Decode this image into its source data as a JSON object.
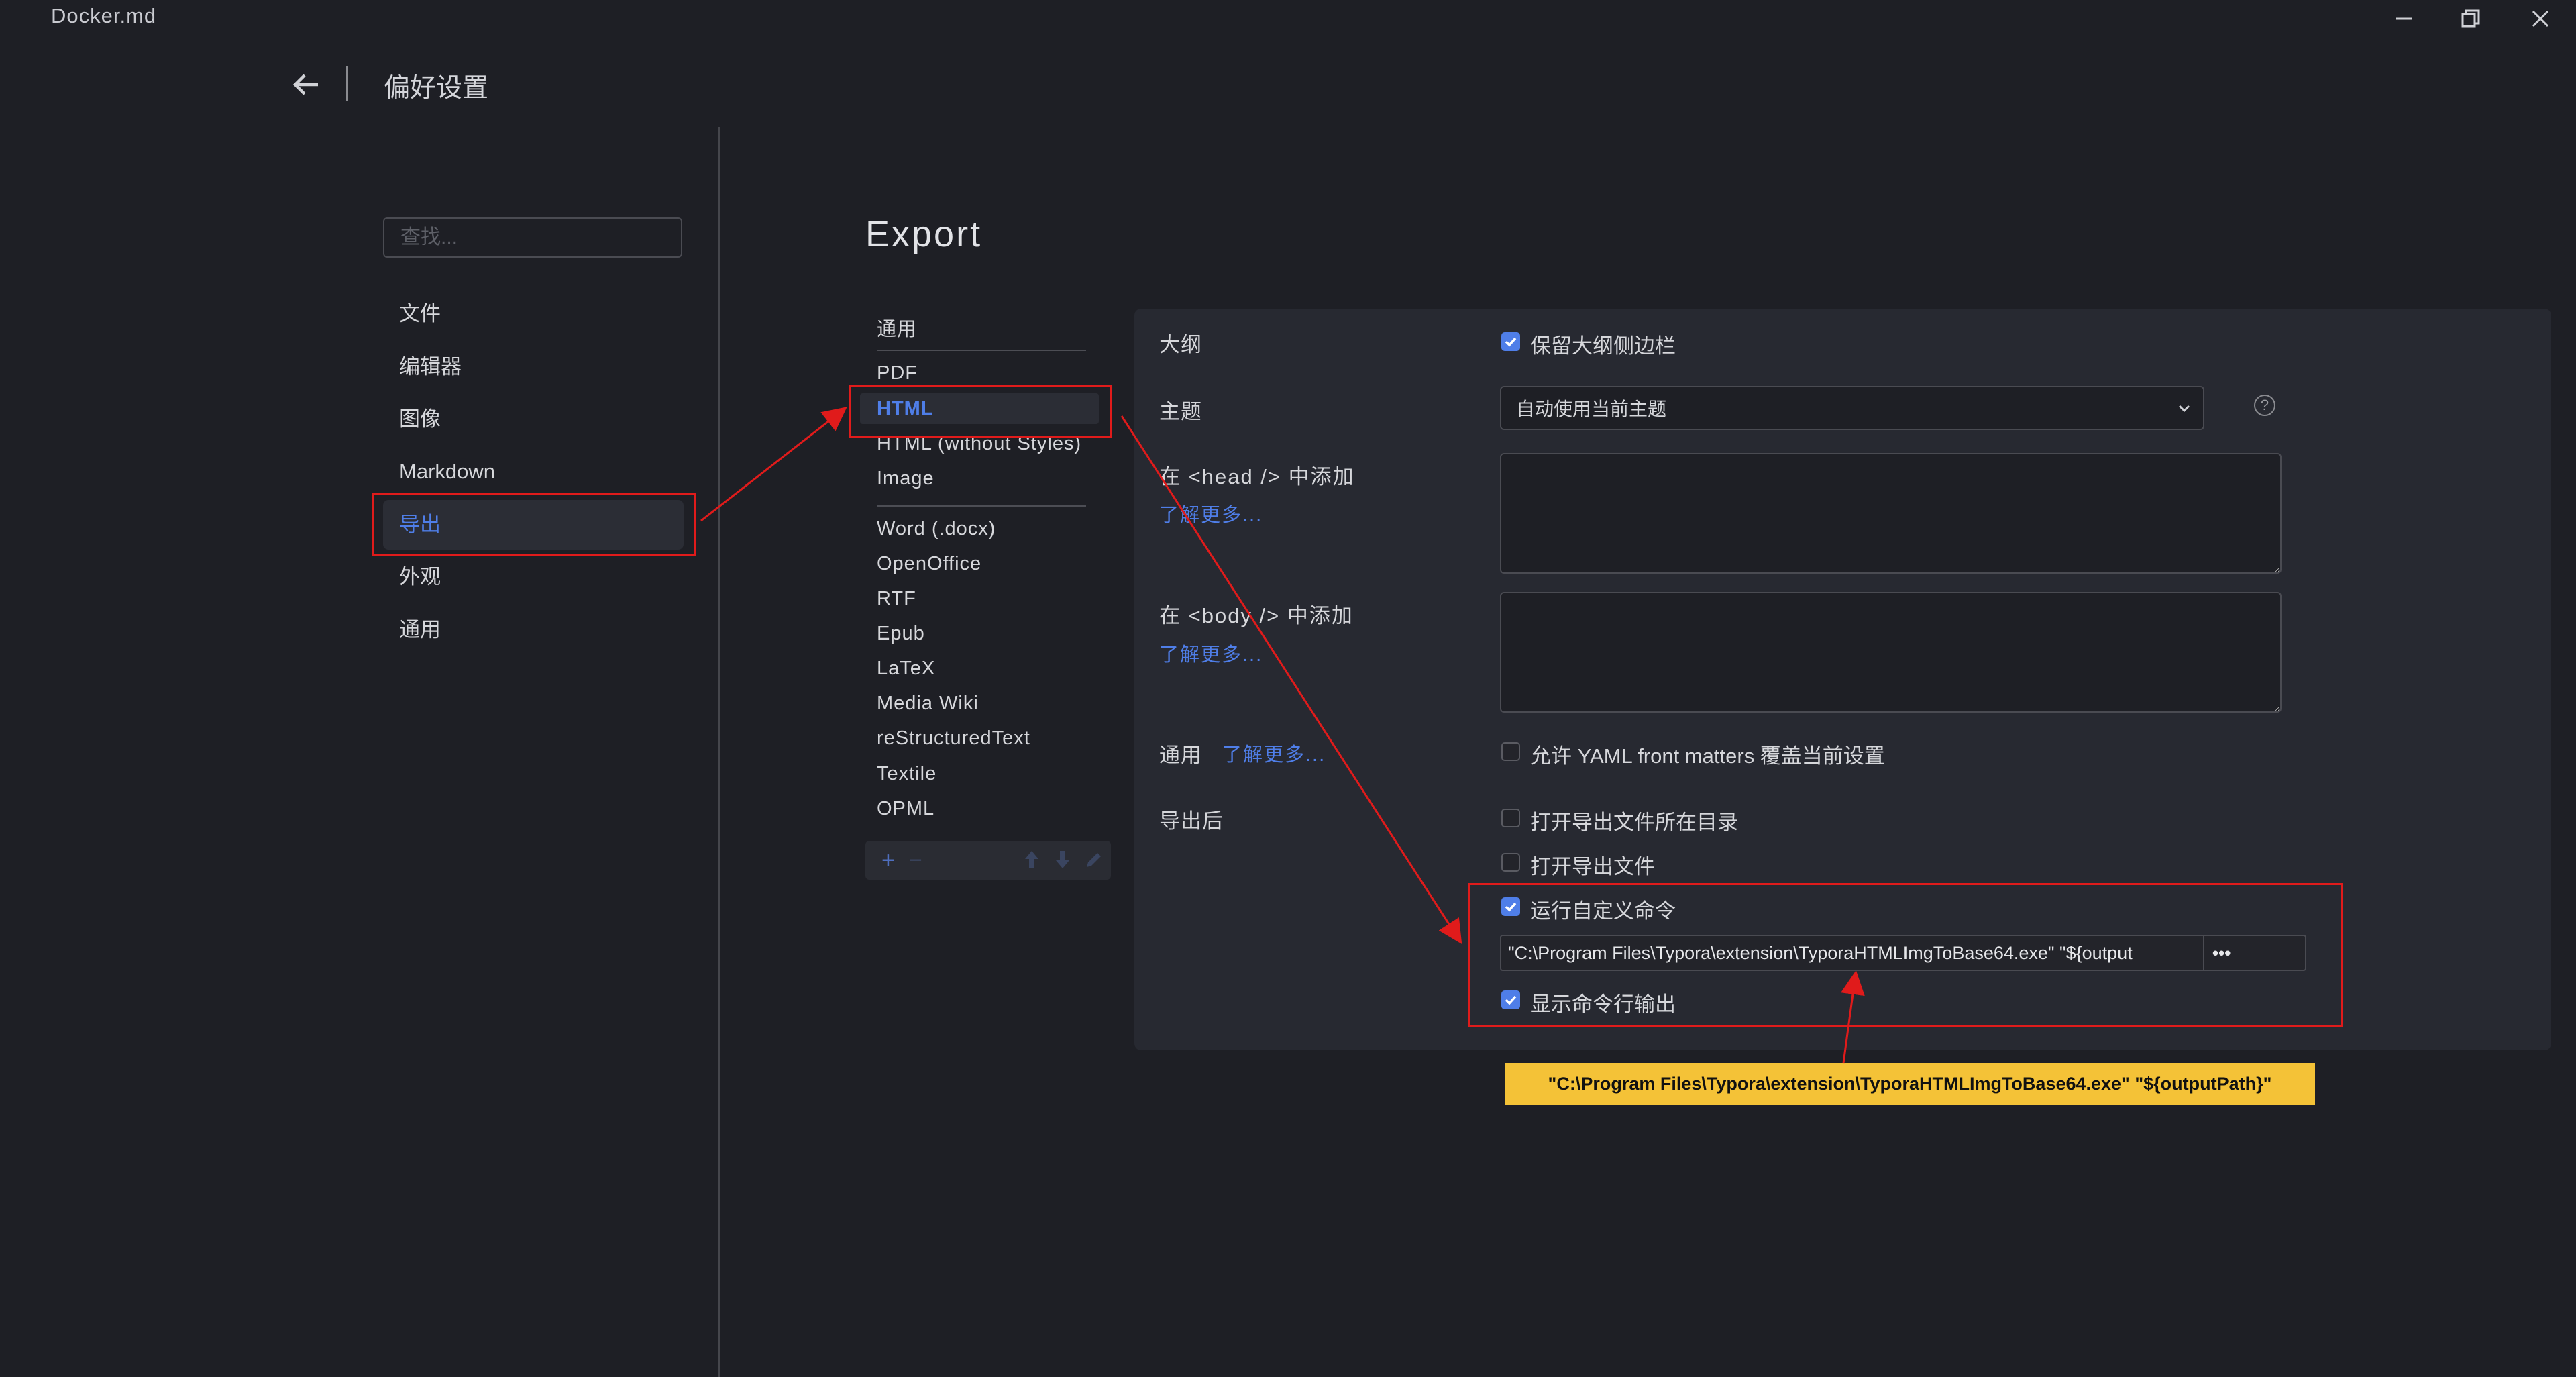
{
  "window": {
    "title": "Docker.md"
  },
  "header": {
    "title": "偏好设置"
  },
  "search": {
    "placeholder": "查找..."
  },
  "nav": {
    "items": [
      {
        "label": "文件"
      },
      {
        "label": "编辑器"
      },
      {
        "label": "图像"
      },
      {
        "label": "Markdown"
      },
      {
        "label": "导出",
        "active": true
      },
      {
        "label": "外观"
      },
      {
        "label": "通用"
      }
    ]
  },
  "export": {
    "title": "Export",
    "formats": [
      {
        "label": "通用"
      },
      {
        "label": "PDF"
      },
      {
        "label": "HTML",
        "active": true
      },
      {
        "label": "HTML (without Styles)"
      },
      {
        "label": "Image"
      },
      {
        "label": "Word (.docx)"
      },
      {
        "label": "OpenOffice"
      },
      {
        "label": "RTF"
      },
      {
        "label": "Epub"
      },
      {
        "label": "LaTeX"
      },
      {
        "label": "Media Wiki"
      },
      {
        "label": "reStructuredText"
      },
      {
        "label": "Textile"
      },
      {
        "label": "OPML"
      }
    ],
    "toolbar": {
      "add": "+",
      "remove": "−"
    }
  },
  "settings": {
    "outline": {
      "label": "大纲",
      "option": "保留大纲侧边栏",
      "checked": true
    },
    "theme": {
      "label": "主题",
      "value": "自动使用当前主题"
    },
    "head": {
      "label": "在 <head /> 中添加",
      "link": "了解更多..."
    },
    "body": {
      "label": "在 <body /> 中添加",
      "link": "了解更多..."
    },
    "general": {
      "label": "通用",
      "link": "了解更多...",
      "option": "允许 YAML front matters 覆盖当前设置",
      "checked": false
    },
    "after_export": {
      "label": "导出后",
      "open_dir": {
        "option": "打开导出文件所在目录",
        "checked": false
      },
      "open_file": {
        "option": "打开导出文件",
        "checked": false
      },
      "run_cmd": {
        "option": "运行自定义命令",
        "checked": true
      },
      "command": "\"C:\\Program Files\\Typora\\extension\\TyporaHTMLImgToBase64.exe\"  \"${output",
      "browse": "•••",
      "show_output": {
        "option": "显示命令行输出",
        "checked": true
      }
    }
  },
  "annotation": {
    "note": "\"C:\\Program Files\\Typora\\extension\\TyporaHTMLImgToBase64.exe\"  \"${outputPath}\""
  },
  "colors": {
    "accent": "#4f7ee8",
    "background": "#1e1f25",
    "panel": "#272931",
    "annotation_red": "#e01b1b",
    "note_yellow": "#f4c237"
  }
}
